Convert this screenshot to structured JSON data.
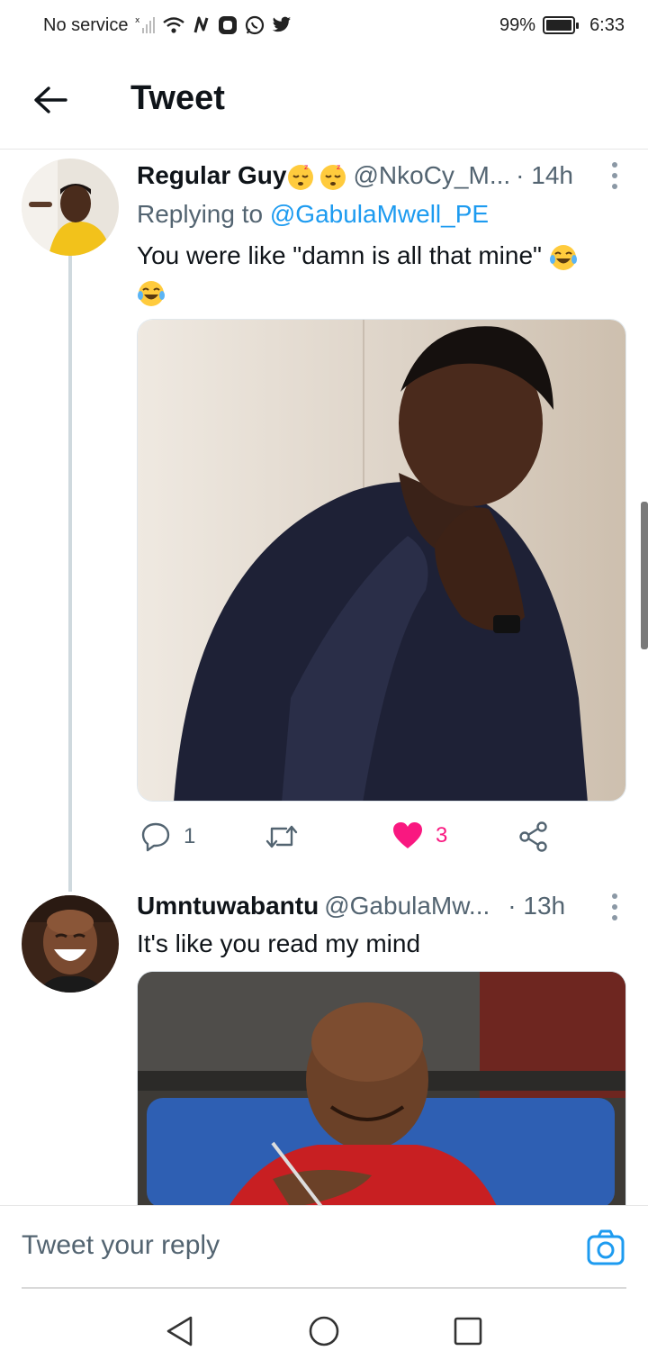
{
  "status_bar": {
    "carrier": "No service",
    "battery": "99%",
    "time": "6:33"
  },
  "header": {
    "title": "Tweet"
  },
  "tweets": [
    {
      "name": "Regular Guy",
      "name_emojis": [
        "sleeping-face",
        "sleeping-face"
      ],
      "handle": "@NkoCy_M...",
      "time": "· 14h",
      "replying_prefix": "Replying to ",
      "replying_to": "@GabulaMwell_PE",
      "text": "You were like \"damn is all that mine\"",
      "text_emojis": [
        "tears-of-joy",
        "tears-of-joy"
      ],
      "reply_count": "1",
      "like_count": "3"
    },
    {
      "name": "Umntuwabantu",
      "handle": "@GabulaMw...",
      "time": "· 13h",
      "text": "It's like you read my mind"
    }
  ],
  "reply_bar": {
    "placeholder": "Tweet your reply"
  },
  "colors": {
    "link": "#1d9bf0",
    "like": "#f91880",
    "muted": "#536471"
  }
}
